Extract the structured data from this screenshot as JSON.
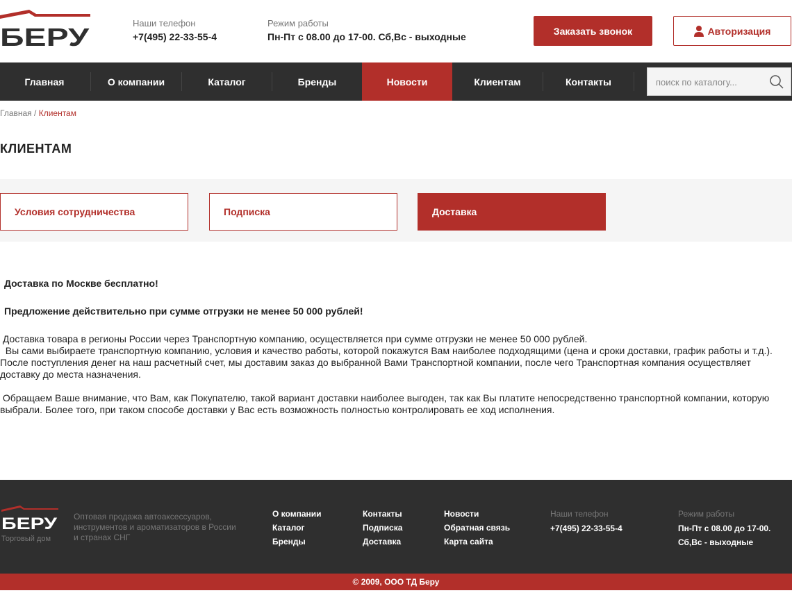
{
  "brand": {
    "logo_text": "БЕРУ",
    "accent": "#b22f2a",
    "dark": "#2f2f2f"
  },
  "header": {
    "phone_label": "Наши телефон",
    "phone": "+7(495) 22-33-55-4",
    "hours_label": "Режим работы",
    "hours": "Пн-Пт с 08.00 до 17-00. Сб,Вс - выходные",
    "call_button": "Заказать звонок",
    "auth_button": "Авторизация",
    "auth_icon": "user-icon"
  },
  "nav": {
    "items": [
      {
        "label": "Главная"
      },
      {
        "label": "О компании"
      },
      {
        "label": "Каталог"
      },
      {
        "label": "Бренды"
      },
      {
        "label": "Новости"
      },
      {
        "label": "Клиентам"
      },
      {
        "label": "Контакты"
      }
    ],
    "active_label": "Новости",
    "search_placeholder": "поиск по каталогу...",
    "search_icon": "search-icon"
  },
  "breadcrumb": {
    "home": "Главная",
    "separator": " / ",
    "current": "Клиентам"
  },
  "page_title": "КЛИЕНТАМ",
  "tabs": [
    {
      "label": "Условия сотрудничества"
    },
    {
      "label": "Подписка"
    },
    {
      "label": "Доставка"
    }
  ],
  "active_tab": "Доставка",
  "content": {
    "p1": "Доставка по Москве бесплатно!",
    "p2": "Предложение действительно при сумме отгрузки не менее 50 000 рублей!",
    "p3a": " Доставка товара в регионы России через Транспортную компанию, осуществляется при сумме отгрузки не менее 50 000 рублей.",
    "p3b": "  Вы сами выбираете транспортную компанию, условия и качество работы, которой покажутся Вам наиболее подходящими (цена и сроки доставки, график работы и т.д.). После поступления денег на наш расчетный счет, мы доставим заказ до выбранной Вами Транспортной компании, после чего Транспортная компания осуществляет доставку до места назначения.",
    "p4": " Обращаем Ваше внимание, что Вам, как Покупателю, такой вариант доставки наиболее выгоден, так как Вы платите непосредственно транспортной компании, которую выбрали. Более того, при таком способе доставки у Вас есть возможность полностью контролировать ее ход исполнения."
  },
  "footer": {
    "logo_sub": "Торговый дом",
    "description": "Оптовая продажа автоаксессуаров, инструментов и ароматизаторов в России и странах СНГ",
    "col1": [
      "О компании",
      "Каталог",
      "Бренды"
    ],
    "col2": [
      "Контакты",
      "Подписка",
      "Доставка"
    ],
    "col3": [
      "Новости",
      "Обратная связь",
      "Карта сайта"
    ],
    "phone_label": "Наши телефон",
    "phone": "+7(495) 22-33-55-4",
    "hours_label": "Режим работы",
    "hours_line1": "Пн-Пт с 08.00 до 17-00.",
    "hours_line2": "Сб,Вс - выходные",
    "copyright": "© 2009, ООО ТД Беру"
  }
}
